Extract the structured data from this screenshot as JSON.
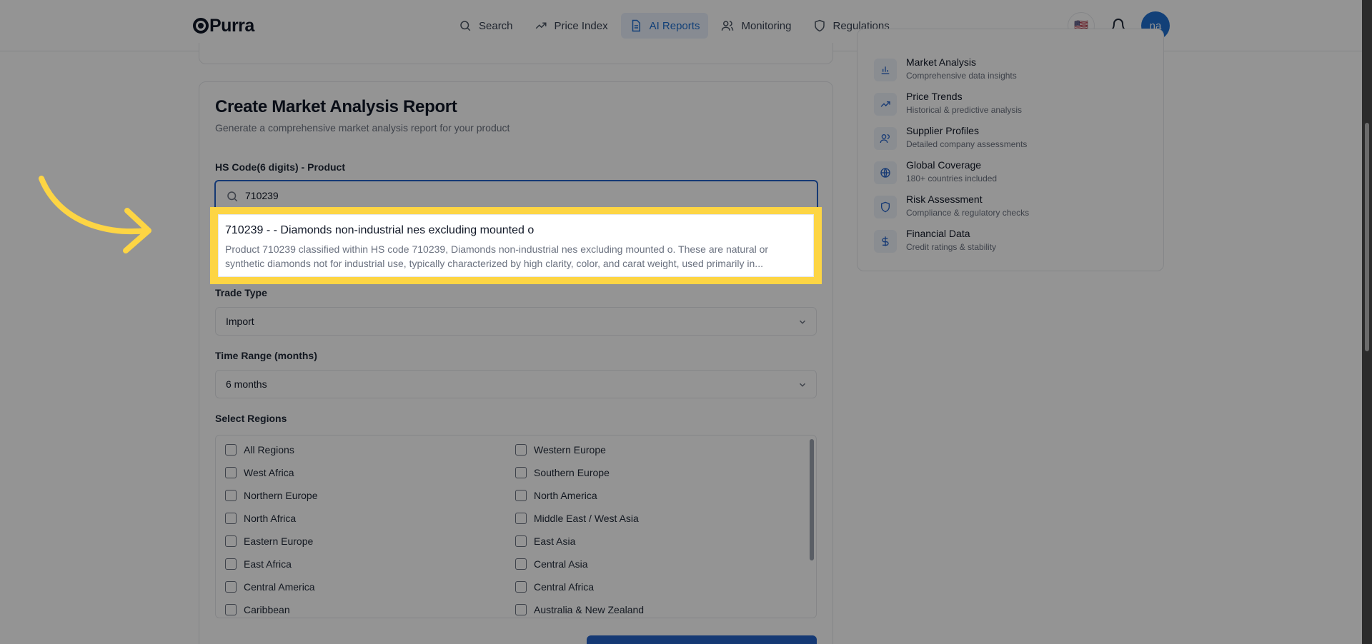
{
  "brand": {
    "name": "Purra"
  },
  "nav": {
    "items": [
      {
        "label": "Search",
        "icon": "search-icon"
      },
      {
        "label": "Price Index",
        "icon": "trend-icon"
      },
      {
        "label": "AI Reports",
        "icon": "document-icon",
        "active": true
      },
      {
        "label": "Monitoring",
        "icon": "users-icon"
      },
      {
        "label": "Regulations",
        "icon": "shield-icon"
      }
    ]
  },
  "header": {
    "flag": "🇺🇸",
    "avatar_initials": "na"
  },
  "form": {
    "title": "Create Market Analysis Report",
    "subtitle": "Generate a comprehensive market analysis report for your product",
    "hs_label": "HS Code(6 digits) - Product",
    "hs_value": "710239",
    "trade_type_label": "Trade Type",
    "trade_type_value": "Import",
    "time_range_label": "Time Range (months)",
    "time_range_value": "6 months",
    "regions_label": "Select Regions",
    "regions_left": [
      "All Regions",
      "West Africa",
      "Northern Europe",
      "North Africa",
      "Eastern Europe",
      "East Africa",
      "Central America",
      "Caribbean"
    ],
    "regions_right": [
      "Western Europe",
      "Southern Europe",
      "North America",
      "Middle East / West Asia",
      "East Asia",
      "Central Asia",
      "Central Africa",
      "Australia & New Zealand"
    ]
  },
  "suggestion": {
    "title": "710239 - - Diamonds non-industrial nes excluding mounted o",
    "desc_line1": "Product 710239 classified within HS code 710239, Diamonds non-industrial nes excluding mounted o. These are natural or",
    "desc_line2": "synthetic diamonds not for industrial use, typically characterized by high clarity, color, and carat weight, used primarily in..."
  },
  "features": [
    {
      "title": "Market Analysis",
      "desc": "Comprehensive data insights",
      "icon": "bar-chart-icon"
    },
    {
      "title": "Price Trends",
      "desc": "Historical & predictive analysis",
      "icon": "trend-icon"
    },
    {
      "title": "Supplier Profiles",
      "desc": "Detailed company assessments",
      "icon": "users-icon"
    },
    {
      "title": "Global Coverage",
      "desc": "180+ countries included",
      "icon": "globe-icon"
    },
    {
      "title": "Risk Assessment",
      "desc": "Compliance & regulatory checks",
      "icon": "shield-icon"
    },
    {
      "title": "Financial Data",
      "desc": "Credit ratings & stability",
      "icon": "dollar-icon"
    }
  ],
  "colors": {
    "accent": "#2563c9",
    "highlight": "#fdd544",
    "overlay": "rgba(0,0,0,0.42)"
  }
}
